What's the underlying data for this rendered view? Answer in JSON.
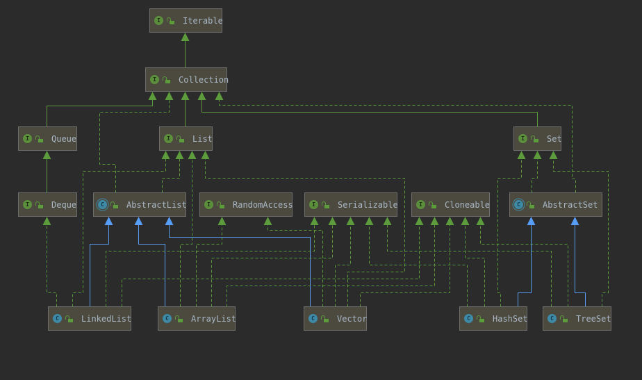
{
  "colors": {
    "background": "#2b2b2b",
    "node_fill": "#4c4a3f",
    "interface_edge": "#5c9c3c",
    "extends_edge": "#589df6",
    "text": "#a9b7c6"
  },
  "nodes": [
    {
      "id": "Iterable",
      "label": "Iterable",
      "kind": "I",
      "icon": "interface-icon"
    },
    {
      "id": "Collection",
      "label": "Collection",
      "kind": "I",
      "icon": "interface-icon"
    },
    {
      "id": "Queue",
      "label": "Queue",
      "kind": "I",
      "icon": "interface-icon"
    },
    {
      "id": "List",
      "label": "List",
      "kind": "I",
      "icon": "interface-icon"
    },
    {
      "id": "Set",
      "label": "Set",
      "kind": "I",
      "icon": "interface-icon"
    },
    {
      "id": "Deque",
      "label": "Deque",
      "kind": "I",
      "icon": "interface-icon"
    },
    {
      "id": "AbstractList",
      "label": "AbstractList",
      "kind": "C",
      "icon": "abstract-class-icon"
    },
    {
      "id": "RandomAccess",
      "label": "RandomAccess",
      "kind": "I",
      "icon": "interface-icon"
    },
    {
      "id": "Serializable",
      "label": "Serializable",
      "kind": "I",
      "icon": "interface-icon"
    },
    {
      "id": "Cloneable",
      "label": "Cloneable",
      "kind": "I",
      "icon": "interface-icon"
    },
    {
      "id": "AbstractSet",
      "label": "AbstractSet",
      "kind": "C",
      "icon": "abstract-class-icon"
    },
    {
      "id": "LinkedList",
      "label": "LinkedList",
      "kind": "C",
      "icon": "class-icon"
    },
    {
      "id": "ArrayList",
      "label": "ArrayList",
      "kind": "C",
      "icon": "class-icon"
    },
    {
      "id": "Vector",
      "label": "Vector",
      "kind": "C",
      "icon": "class-icon"
    },
    {
      "id": "HashSet",
      "label": "HashSet",
      "kind": "C",
      "icon": "class-icon"
    },
    {
      "id": "TreeSet",
      "label": "TreeSet",
      "kind": "C",
      "icon": "class-icon"
    }
  ],
  "edges": [
    {
      "from": "Collection",
      "to": "Iterable",
      "type": "extends-interface"
    },
    {
      "from": "Queue",
      "to": "Collection",
      "type": "extends-interface"
    },
    {
      "from": "List",
      "to": "Collection",
      "type": "extends-interface"
    },
    {
      "from": "Set",
      "to": "Collection",
      "type": "extends-interface"
    },
    {
      "from": "AbstractList",
      "to": "Collection",
      "type": "implements"
    },
    {
      "from": "AbstractSet",
      "to": "Collection",
      "type": "implements"
    },
    {
      "from": "Deque",
      "to": "Queue",
      "type": "extends-interface"
    },
    {
      "from": "LinkedList",
      "to": "List",
      "type": "implements"
    },
    {
      "from": "AbstractList",
      "to": "List",
      "type": "implements"
    },
    {
      "from": "ArrayList",
      "to": "List",
      "type": "implements"
    },
    {
      "from": "Vector",
      "to": "List",
      "type": "implements"
    },
    {
      "from": "AbstractSet",
      "to": "Set",
      "type": "implements"
    },
    {
      "from": "HashSet",
      "to": "Set",
      "type": "implements"
    },
    {
      "from": "TreeSet",
      "to": "Set",
      "type": "implements"
    },
    {
      "from": "LinkedList",
      "to": "Deque",
      "type": "implements"
    },
    {
      "from": "LinkedList",
      "to": "AbstractList",
      "type": "extends"
    },
    {
      "from": "ArrayList",
      "to": "AbstractList",
      "type": "extends"
    },
    {
      "from": "Vector",
      "to": "AbstractList",
      "type": "extends"
    },
    {
      "from": "ArrayList",
      "to": "RandomAccess",
      "type": "implements"
    },
    {
      "from": "Vector",
      "to": "RandomAccess",
      "type": "implements"
    },
    {
      "from": "LinkedList",
      "to": "Serializable",
      "type": "implements"
    },
    {
      "from": "ArrayList",
      "to": "Serializable",
      "type": "implements"
    },
    {
      "from": "Vector",
      "to": "Serializable",
      "type": "implements"
    },
    {
      "from": "HashSet",
      "to": "Serializable",
      "type": "implements"
    },
    {
      "from": "TreeSet",
      "to": "Serializable",
      "type": "implements"
    },
    {
      "from": "LinkedList",
      "to": "Cloneable",
      "type": "implements"
    },
    {
      "from": "ArrayList",
      "to": "Cloneable",
      "type": "implements"
    },
    {
      "from": "Vector",
      "to": "Cloneable",
      "type": "implements"
    },
    {
      "from": "HashSet",
      "to": "Cloneable",
      "type": "implements"
    },
    {
      "from": "TreeSet",
      "to": "Cloneable",
      "type": "implements"
    },
    {
      "from": "HashSet",
      "to": "AbstractSet",
      "type": "extends"
    },
    {
      "from": "TreeSet",
      "to": "AbstractSet",
      "type": "extends"
    }
  ]
}
